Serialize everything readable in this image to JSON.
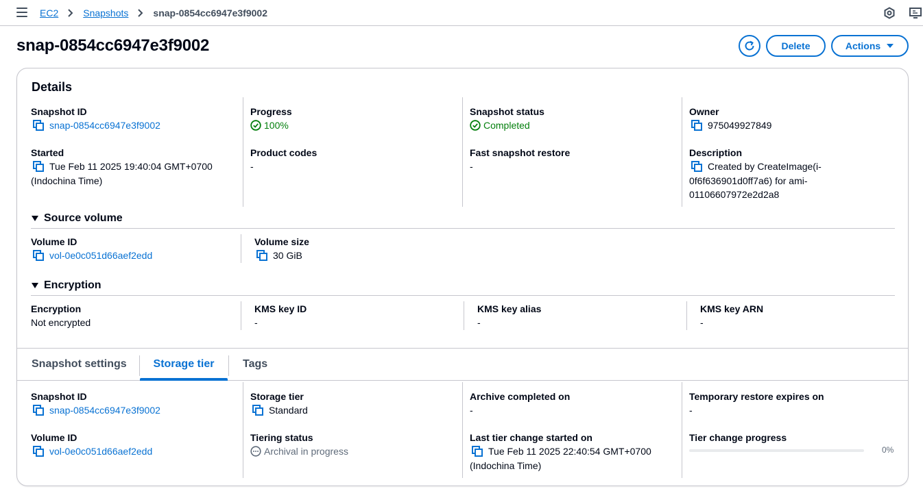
{
  "breadcrumb": {
    "items": [
      "EC2",
      "Snapshots"
    ],
    "current": "snap-0854cc6947e3f9002"
  },
  "header": {
    "title": "snap-0854cc6947e3f9002",
    "delete_label": "Delete",
    "actions_label": "Actions"
  },
  "details": {
    "title": "Details",
    "snapshot_id": {
      "label": "Snapshot ID",
      "value": "snap-0854cc6947e3f9002"
    },
    "progress": {
      "label": "Progress",
      "value": "100%"
    },
    "snapshot_status": {
      "label": "Snapshot status",
      "value": "Completed"
    },
    "owner": {
      "label": "Owner",
      "value": "975049927849"
    },
    "started": {
      "label": "Started",
      "value": "Tue Feb 11 2025 19:40:04 GMT+0700",
      "value2": "(Indochina Time)"
    },
    "product_codes": {
      "label": "Product codes",
      "value": "-"
    },
    "fast_snapshot_restore": {
      "label": "Fast snapshot restore",
      "value": "-"
    },
    "description": {
      "label": "Description",
      "line1": "Created by CreateImage(i-",
      "line2": "0f6f636901d0ff7a6) for ami-",
      "line3": "01106607972e2d2a8"
    }
  },
  "source_volume": {
    "title": "Source volume",
    "volume_id": {
      "label": "Volume ID",
      "value": "vol-0e0c051d66aef2edd"
    },
    "volume_size": {
      "label": "Volume size",
      "value": "30 GiB"
    }
  },
  "encryption": {
    "title": "Encryption",
    "encryption": {
      "label": "Encryption",
      "value": "Not encrypted"
    },
    "kms_key_id": {
      "label": "KMS key ID",
      "value": "-"
    },
    "kms_key_alias": {
      "label": "KMS key alias",
      "value": "-"
    },
    "kms_key_arn": {
      "label": "KMS key ARN",
      "value": "-"
    }
  },
  "tabs": [
    {
      "label": "Snapshot settings"
    },
    {
      "label": "Storage tier"
    },
    {
      "label": "Tags"
    }
  ],
  "storage_tier": {
    "snapshot_id": {
      "label": "Snapshot ID",
      "value": "snap-0854cc6947e3f9002"
    },
    "storage_tier": {
      "label": "Storage tier",
      "value": "Standard"
    },
    "archive_completed_on": {
      "label": "Archive completed on",
      "value": "-"
    },
    "temporary_restore_expires_on": {
      "label": "Temporary restore expires on",
      "value": "-"
    },
    "volume_id": {
      "label": "Volume ID",
      "value": "vol-0e0c051d66aef2edd"
    },
    "tiering_status": {
      "label": "Tiering status",
      "value": "Archival in progress"
    },
    "last_tier_change_started_on": {
      "label": "Last tier change started on",
      "value": "Tue Feb 11 2025 22:40:54 GMT+0700",
      "value2": "(Indochina Time)"
    },
    "tier_change_progress": {
      "label": "Tier change progress",
      "value": "0%",
      "fraction": 0
    }
  },
  "colors": {
    "link": "#0972d3",
    "success": "#037f0c",
    "border": "#c6c6cd"
  },
  "icons": [
    "menu-icon",
    "chevron-right-icon",
    "settings-icon",
    "feedback-icon",
    "refresh-icon",
    "caret-down-icon",
    "copy-icon",
    "status-success-icon",
    "status-in-progress-icon",
    "caret-expanded-icon"
  ]
}
